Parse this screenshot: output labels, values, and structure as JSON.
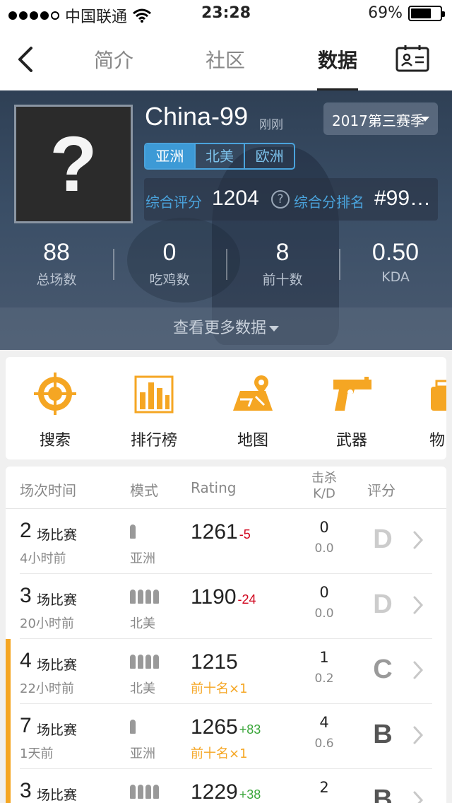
{
  "status": {
    "carrier": "中国联通",
    "time": "23:28",
    "battery": "69%",
    "battery_level": 0.69
  },
  "nav": {
    "tabs": [
      "简介",
      "社区",
      "数据"
    ],
    "active_tab": 2
  },
  "profile": {
    "name": "China-99",
    "updated": "刚刚",
    "avatar_glyph": "?",
    "season": "2017第三赛季",
    "regions": [
      "亚洲",
      "北美",
      "欧洲"
    ],
    "active_region": 0,
    "score_label": "综合评分",
    "score": "1204",
    "help_glyph": "?",
    "rank_label": "综合分排名",
    "rank": "#99…"
  },
  "stats": [
    {
      "value": "88",
      "label": "总场数"
    },
    {
      "value": "0",
      "label": "吃鸡数"
    },
    {
      "value": "8",
      "label": "前十数"
    },
    {
      "value": "0.50",
      "label": "KDA"
    }
  ],
  "more_label": "查看更多数据",
  "menu": [
    {
      "label": "搜索",
      "icon": "crosshair-icon"
    },
    {
      "label": "排行榜",
      "icon": "leaderboard-icon"
    },
    {
      "label": "地图",
      "icon": "map-icon"
    },
    {
      "label": "武器",
      "icon": "pistol-icon"
    },
    {
      "label": "物",
      "icon": "item-icon"
    }
  ],
  "accent": "#f5a623",
  "table": {
    "headers": {
      "time": "场次时间",
      "mode": "模式",
      "rating": "Rating",
      "kills": "击杀",
      "kd": "K/D",
      "grade": "评分"
    },
    "rows": [
      {
        "count": "2",
        "count_label": "场比赛",
        "ago": "4小时前",
        "mode": "亚洲",
        "players": 1,
        "rating": "1261",
        "delta": "-5",
        "delta_sign": "neg",
        "top10": "",
        "kills": "0",
        "kd": "0.0",
        "grade": "D",
        "highlight": false
      },
      {
        "count": "3",
        "count_label": "场比赛",
        "ago": "20小时前",
        "mode": "北美",
        "players": 4,
        "rating": "1190",
        "delta": "-24",
        "delta_sign": "neg",
        "top10": "",
        "kills": "0",
        "kd": "0.0",
        "grade": "D",
        "highlight": false
      },
      {
        "count": "4",
        "count_label": "场比赛",
        "ago": "22小时前",
        "mode": "北美",
        "players": 4,
        "rating": "1215",
        "delta": "",
        "delta_sign": "",
        "top10": "前十名×1",
        "kills": "1",
        "kd": "0.2",
        "grade": "C",
        "highlight": true
      },
      {
        "count": "7",
        "count_label": "场比赛",
        "ago": "1天前",
        "mode": "亚洲",
        "players": 1,
        "rating": "1265",
        "delta": "+83",
        "delta_sign": "pos",
        "top10": "前十名×1",
        "kills": "4",
        "kd": "0.6",
        "grade": "B",
        "highlight": true
      },
      {
        "count": "3",
        "count_label": "场比赛",
        "ago": "",
        "mode": "",
        "players": 4,
        "rating": "1229",
        "delta": "+38",
        "delta_sign": "pos",
        "top10": "",
        "kills": "2",
        "kd": "",
        "grade": "B",
        "highlight": true
      }
    ]
  }
}
